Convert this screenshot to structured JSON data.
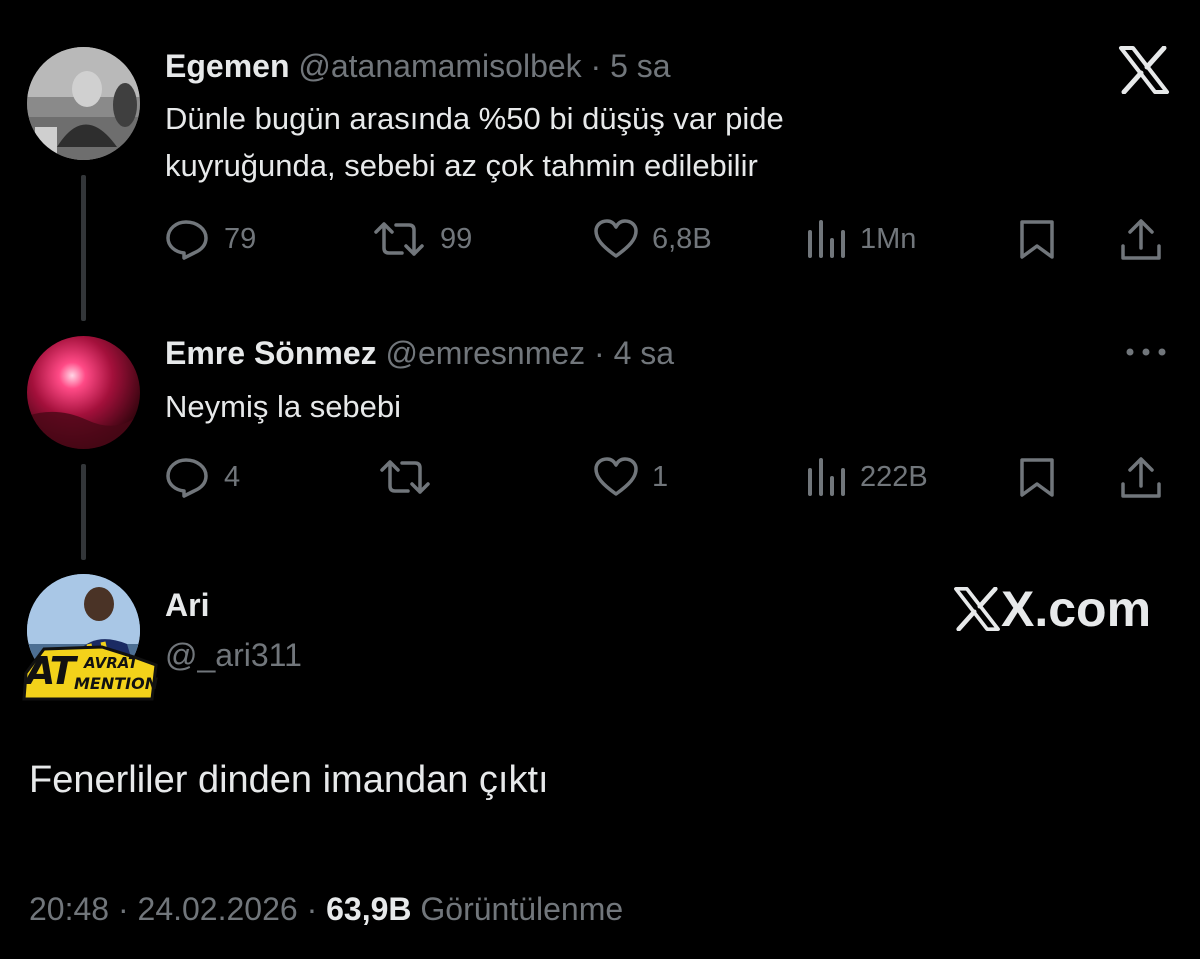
{
  "brand": {
    "top_logo": "X",
    "watermark": "X.com"
  },
  "tweets": [
    {
      "display_name": "Egemen",
      "handle": "@atanamamisolbek",
      "separator": "·",
      "time": "5 sa",
      "text_line1": "Dünle bugün arasında %50 bi düşüş var pide",
      "text_line2": "kuyruğunda, sebebi az çok tahmin edilebilir",
      "replies": "79",
      "reposts": "99",
      "likes": "6,8B",
      "views": "1Mn"
    },
    {
      "display_name": "Emre Sönmez",
      "handle": "@emresnmez",
      "separator": "·",
      "time": "4 sa",
      "text_line1": "Neymiş la sebebi",
      "replies": "4",
      "likes": "1",
      "views": "222B"
    }
  ],
  "main_tweet": {
    "display_name": "Ari",
    "handle": "@_ari311",
    "badge_text_top": "AVRAT",
    "badge_text_left": "AT",
    "badge_text_bottom": "MENTION",
    "text": "Fenerliler dinden imandan çıktı",
    "time": "20:48",
    "sep1": "·",
    "date": "24.02.2026",
    "sep2": "·",
    "views_count": "63,9B",
    "views_label": "Görüntülenme"
  },
  "icons": [
    "reply-icon",
    "repost-icon",
    "like-icon",
    "views-icon",
    "bookmark-icon",
    "share-icon",
    "more-icon",
    "x-logo-icon"
  ],
  "colors": {
    "background": "#000000",
    "text": "#e7e9ea",
    "muted": "#71767b",
    "thread_line": "#333639",
    "badge_yellow": "#f3d21a"
  }
}
